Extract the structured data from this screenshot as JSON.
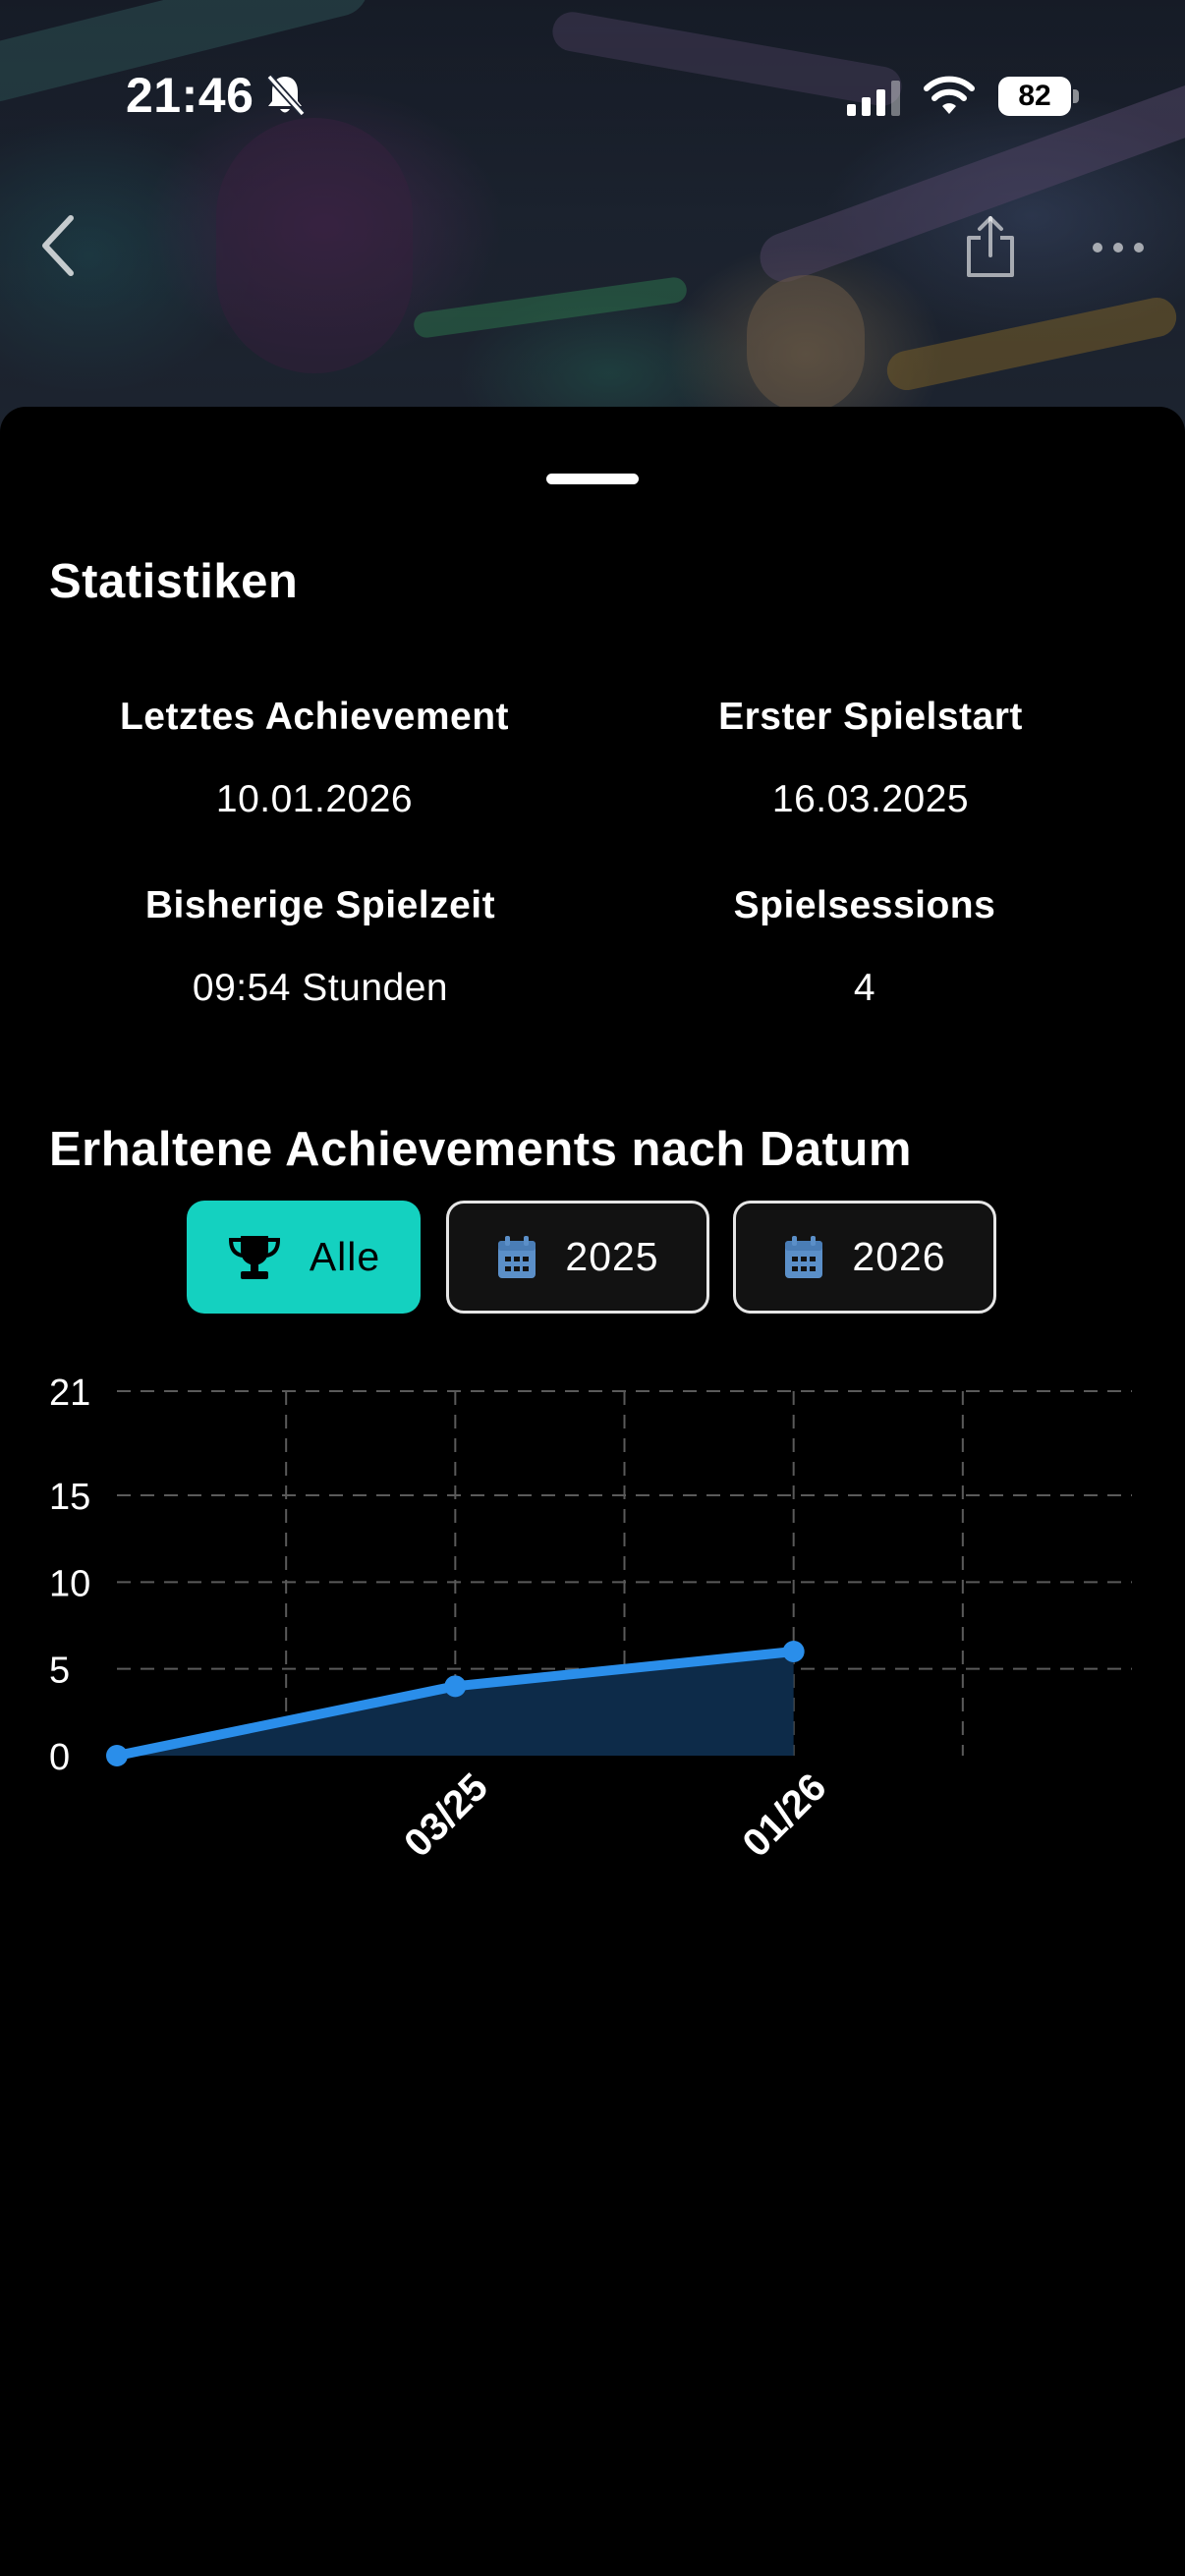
{
  "status_bar": {
    "time": "21:46",
    "battery": "82"
  },
  "nav": {
    "back_icon": "chevron-left-icon",
    "share_icon": "share-icon",
    "more_icon": "more-horizontal-icon"
  },
  "stats": {
    "title": "Statistiken",
    "last_achievement": {
      "label": "Letztes Achievement",
      "value": "10.01.2026"
    },
    "first_start": {
      "label": "Erster Spielstart",
      "value": "16.03.2025"
    },
    "playtime": {
      "label": "Bisherige Spielzeit",
      "value": "09:54 Stunden"
    },
    "sessions": {
      "label": "Spielsessions",
      "value": "4"
    }
  },
  "achievements_chart": {
    "title": "Erhaltene Achievements nach Datum",
    "filters": [
      {
        "label": "Alle",
        "icon": "trophy-icon",
        "active": true
      },
      {
        "label": "2025",
        "icon": "calendar-icon",
        "active": false
      },
      {
        "label": "2026",
        "icon": "calendar-icon",
        "active": false
      }
    ]
  },
  "colors": {
    "accent": "#14d1c0",
    "line": "#2a8eea",
    "area": "#0d2b49"
  },
  "chart_data": {
    "type": "area",
    "title": "Erhaltene Achievements nach Datum",
    "x": [
      0,
      2,
      4
    ],
    "y": [
      0,
      4,
      6
    ],
    "x_tick_positions": [
      2,
      4
    ],
    "x_tick_labels": [
      "03/25",
      "01/26"
    ],
    "y_ticks": [
      0,
      5,
      10,
      15,
      21
    ],
    "xlim": [
      0,
      6
    ],
    "ylim": [
      0,
      21
    ],
    "grid": true,
    "xlabel": "",
    "ylabel": ""
  }
}
